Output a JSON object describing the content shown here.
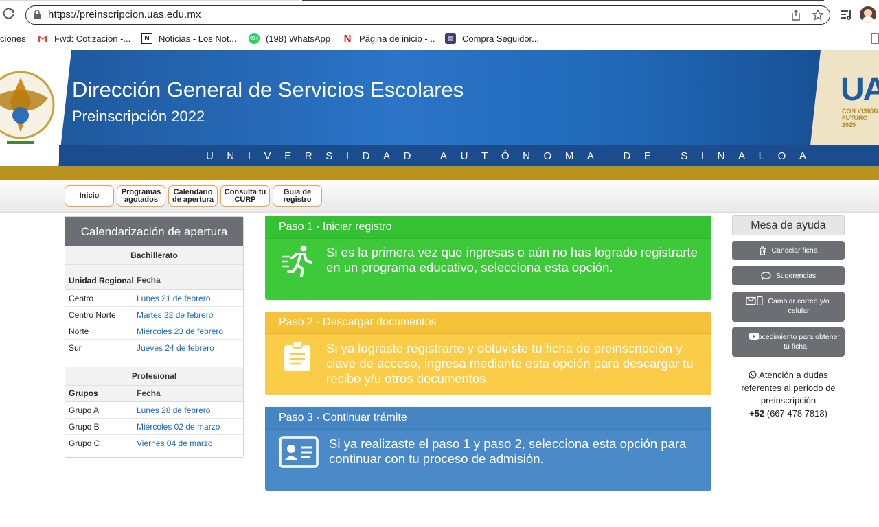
{
  "browser": {
    "url": "https://preinscripcion.uas.edu.mx",
    "bookmarks": [
      {
        "label": "ciones",
        "icon": "apps-icon"
      },
      {
        "label": "Fwd: Cotizacion -...",
        "icon": "gmail-icon"
      },
      {
        "label": "Noticias - Los Not...",
        "icon": "noticias-icon"
      },
      {
        "label": "(198) WhatsApp",
        "icon": "whatsapp-icon"
      },
      {
        "label": "Página de inicio -...",
        "icon": "netflix-icon"
      },
      {
        "label": "Compra Seguidor...",
        "icon": "shop-icon"
      }
    ]
  },
  "header": {
    "title": "Dirección General de Servicios Escolares",
    "subtitle": "Preinscripción 2022",
    "university": "UNIVERSIDAD AUTÓNOMA DE SINALOA",
    "logo_right_text": {
      "brand": "UA",
      "line1": "CON VISIÓN",
      "line2": "FUTURO",
      "line3": "2025"
    }
  },
  "nav": [
    {
      "label": "Inicio"
    },
    {
      "label": "Programas agotados"
    },
    {
      "label": "Calendario de apertura"
    },
    {
      "label": "Consulta tu CURP"
    },
    {
      "label": "Guía de registro"
    }
  ],
  "calendar": {
    "title": "Calendarización de apertura",
    "bachillerato": {
      "section": "Bachillerato",
      "col1": "Unidad Regional",
      "col2": "Fecha",
      "rows": [
        {
          "name": "Centro",
          "date": "Lunes 21 de febrero"
        },
        {
          "name": "Centro Norte",
          "date": "Martes 22 de febrero"
        },
        {
          "name": "Norte",
          "date": "Miércoles 23 de febrero"
        },
        {
          "name": "Sur",
          "date": "Jueves 24 de febrero"
        }
      ]
    },
    "profesional": {
      "section": "Profesional",
      "col1": "Grupos",
      "col2": "Fecha",
      "rows": [
        {
          "name": "Grupo A",
          "date": "Lunes 28 de febrero"
        },
        {
          "name": "Grupo B",
          "date": "Miércoles 02 de marzo"
        },
        {
          "name": "Grupo C",
          "date": "Viernes 04 de marzo"
        }
      ]
    }
  },
  "steps": [
    {
      "title": "Paso 1 - Iniciar registro",
      "text": "Si es la primera vez que ingresas o aún no has logrado registrarte en un programa educativo, selecciona esta opción.",
      "icon": "running-person-icon",
      "color": "#3ec93a",
      "title_color": "#35c232"
    },
    {
      "title": "Paso 2 - Descargar documentos",
      "text": "Si ya lograste registrarte y obtuviste tu ficha de preinscripción y clave de acceso, ingresa mediante esta opción para descargar tu recibo y/u otros documentos.",
      "icon": "clipboard-icon",
      "color": "#fbcc47",
      "title_color": "#f6c23a"
    },
    {
      "title": "Paso 3 - Continuar trámite",
      "text": "Si ya realizaste el paso 1 y paso 2, selecciona esta opción para continuar con tu proceso de admisión.",
      "icon": "id-card-icon",
      "color": "#4a8ac8",
      "title_color": "#4585c3"
    }
  ],
  "help": {
    "title": "Mesa de ayuda",
    "buttons": [
      {
        "label": "Cancelar ficha",
        "icon": "trash-icon"
      },
      {
        "label": "Sugerencias",
        "icon": "comment-icon"
      },
      {
        "label": "Cambiar correo y/o celular",
        "icon": "mail-phone-icon"
      },
      {
        "label": "Procedimiento para obtener tu ficha",
        "icon": "youtube-icon"
      }
    ],
    "info_text": "Atención a dudas referentes al periodo de preinscripción",
    "phone_prefix": "+52",
    "phone_number": "(667 478 7818)"
  }
}
